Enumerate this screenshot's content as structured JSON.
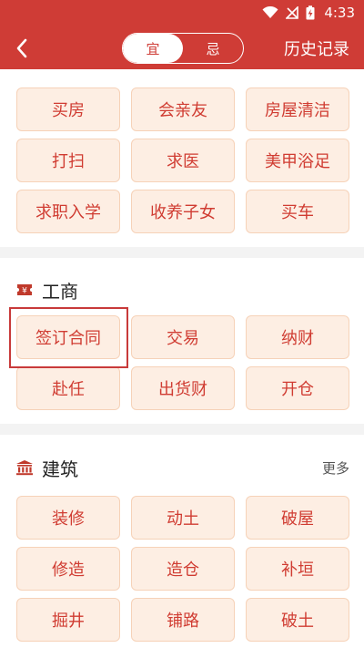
{
  "status_bar": {
    "time": "4:33"
  },
  "header": {
    "back_icon": "chevron-left-icon",
    "segments": [
      {
        "label": "宜",
        "active": true
      },
      {
        "label": "忌",
        "active": false
      }
    ],
    "history_label": "历史记录"
  },
  "top_tags": [
    "买房",
    "会亲友",
    "房屋清洁",
    "打扫",
    "求医",
    "美甲浴足",
    "求职入学",
    "收养子女",
    "买车"
  ],
  "sections": [
    {
      "title": "工商",
      "icon": "money-ticket-icon",
      "tags": [
        "签订合同",
        "交易",
        "纳财",
        "赴任",
        "出货财",
        "开仓"
      ]
    },
    {
      "title": "建筑",
      "icon": "building-columns-icon",
      "more_label": "更多",
      "tags": [
        "装修",
        "动土",
        "破屋",
        "修造",
        "造仓",
        "补垣",
        "掘井",
        "铺路",
        "破土"
      ]
    }
  ],
  "colors": {
    "brand_red": "#cf3c36",
    "tag_bg": "#fdeee3",
    "tag_border": "#f6d2b8",
    "tag_text": "#d03c32"
  }
}
